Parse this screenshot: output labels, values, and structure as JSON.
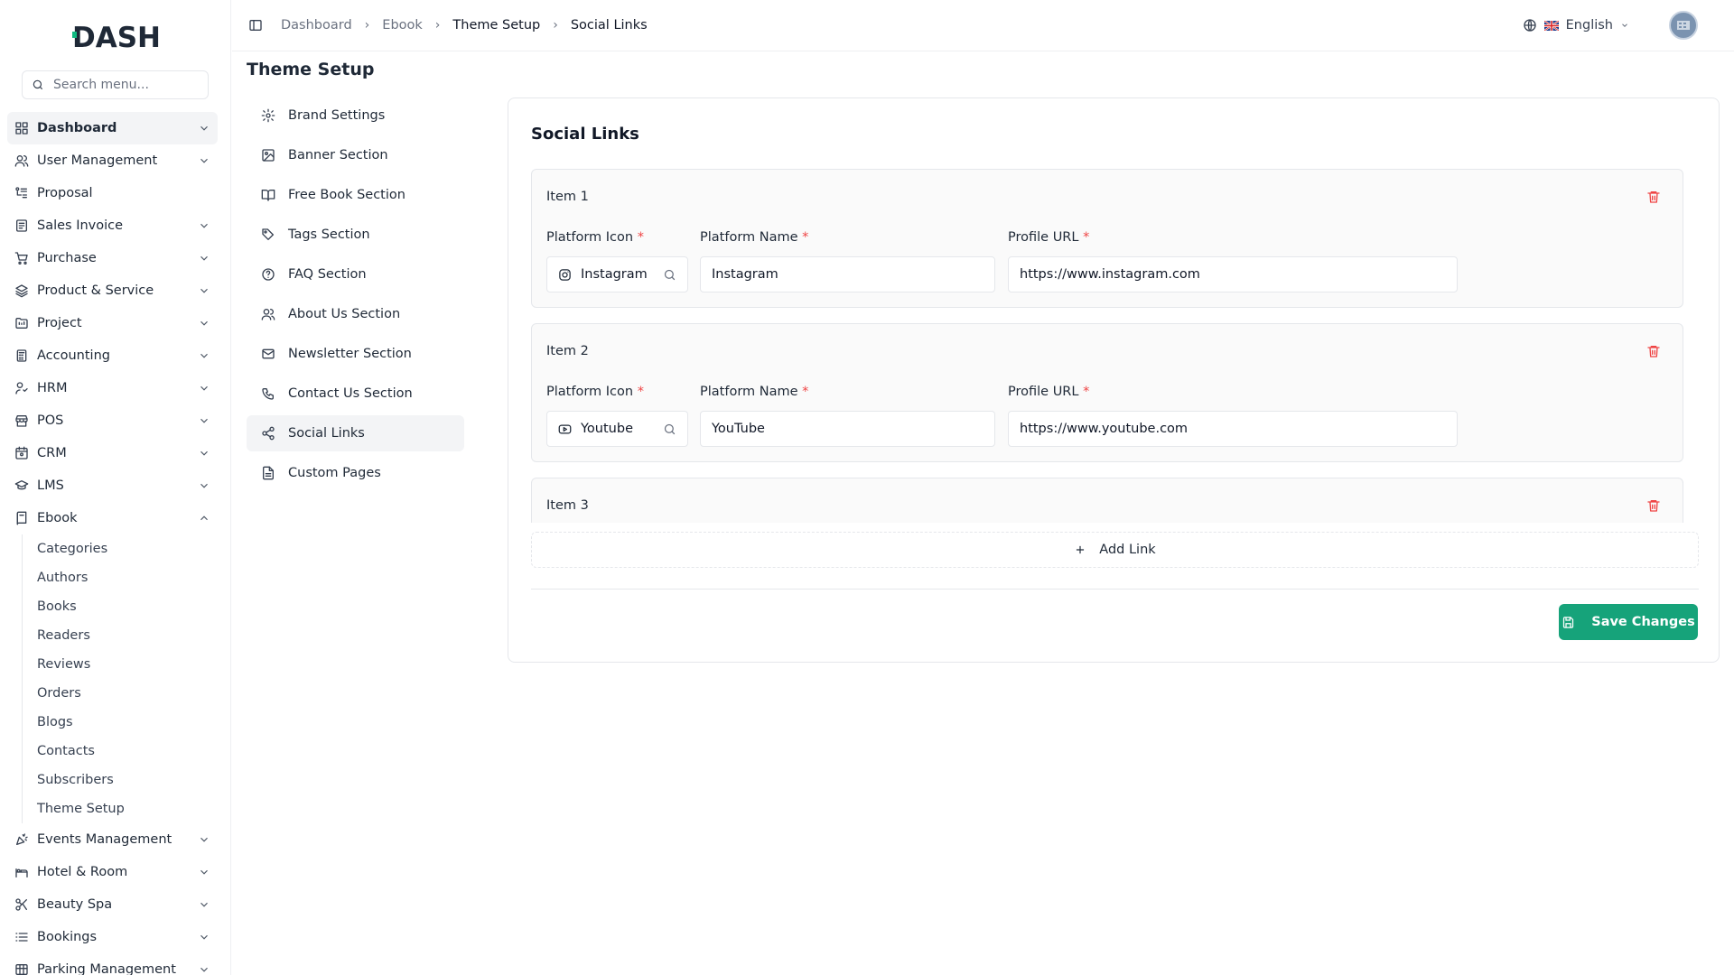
{
  "app": {
    "logo_text": "DASH"
  },
  "sidebar": {
    "search_placeholder": "Search menu...",
    "items": [
      {
        "label": "Dashboard",
        "icon": "dashboard-icon",
        "chevron": "down",
        "active": true
      },
      {
        "label": "User Management",
        "icon": "users-icon",
        "chevron": "down"
      },
      {
        "label": "Proposal",
        "icon": "proposal-icon",
        "chevron": ""
      },
      {
        "label": "Sales Invoice",
        "icon": "invoice-icon",
        "chevron": "down"
      },
      {
        "label": "Purchase",
        "icon": "cart-icon",
        "chevron": "down"
      },
      {
        "label": "Product & Service",
        "icon": "layers-icon",
        "chevron": "down"
      },
      {
        "label": "Project",
        "icon": "folder-icon",
        "chevron": "down"
      },
      {
        "label": "Accounting",
        "icon": "calculator-icon",
        "chevron": "down"
      },
      {
        "label": "HRM",
        "icon": "hrm-icon",
        "chevron": "down"
      },
      {
        "label": "POS",
        "icon": "store-icon",
        "chevron": "down"
      },
      {
        "label": "CRM",
        "icon": "crm-icon",
        "chevron": "down"
      },
      {
        "label": "LMS",
        "icon": "graduation-icon",
        "chevron": "down"
      },
      {
        "label": "Ebook",
        "icon": "book-icon",
        "chevron": "up"
      }
    ],
    "ebook_sub": [
      "Categories",
      "Authors",
      "Books",
      "Readers",
      "Reviews",
      "Orders",
      "Blogs",
      "Contacts",
      "Subscribers",
      "Theme Setup"
    ],
    "items_after": [
      {
        "label": "Events Management",
        "icon": "party-icon",
        "chevron": "down"
      },
      {
        "label": "Hotel & Room",
        "icon": "hotel-icon",
        "chevron": "down"
      },
      {
        "label": "Beauty Spa",
        "icon": "scissors-icon",
        "chevron": "down"
      },
      {
        "label": "Bookings",
        "icon": "list-icon",
        "chevron": "down"
      },
      {
        "label": "Parking Management",
        "icon": "parking-icon",
        "chevron": "down"
      }
    ]
  },
  "header": {
    "breadcrumb": [
      "Dashboard",
      "Ebook",
      "Theme Setup",
      "Social Links"
    ],
    "language": "English"
  },
  "page": {
    "title": "Theme Setup",
    "sub_nav": [
      {
        "label": "Brand Settings",
        "icon": "gear-icon"
      },
      {
        "label": "Banner Section",
        "icon": "image-icon"
      },
      {
        "label": "Free Book Section",
        "icon": "open-book-icon"
      },
      {
        "label": "Tags Section",
        "icon": "tag-icon"
      },
      {
        "label": "FAQ Section",
        "icon": "question-icon"
      },
      {
        "label": "About Us Section",
        "icon": "users-icon"
      },
      {
        "label": "Newsletter Section",
        "icon": "mail-icon"
      },
      {
        "label": "Contact Us Section",
        "icon": "phone-icon"
      },
      {
        "label": "Social Links",
        "icon": "share-icon",
        "active": true
      },
      {
        "label": "Custom Pages",
        "icon": "file-icon"
      }
    ]
  },
  "social_links": {
    "title": "Social Links",
    "labels": {
      "platform_icon": "Platform Icon",
      "platform_name": "Platform Name",
      "profile_url": "Profile URL",
      "required_mark": "*"
    },
    "items": [
      {
        "title": "Item 1",
        "icon_name": "Instagram",
        "icon": "instagram-icon",
        "platform_name": "Instagram",
        "profile_url": "https://www.instagram.com"
      },
      {
        "title": "Item 2",
        "icon_name": "Youtube",
        "icon": "youtube-icon",
        "platform_name": "YouTube",
        "profile_url": "https://www.youtube.com"
      },
      {
        "title": "Item 3"
      }
    ],
    "add_link_label": "Add Link",
    "save_label": "Save Changes"
  },
  "colors": {
    "accent": "#16a37a",
    "danger": "#ef4444",
    "active_bg": "#f3f4f6"
  }
}
